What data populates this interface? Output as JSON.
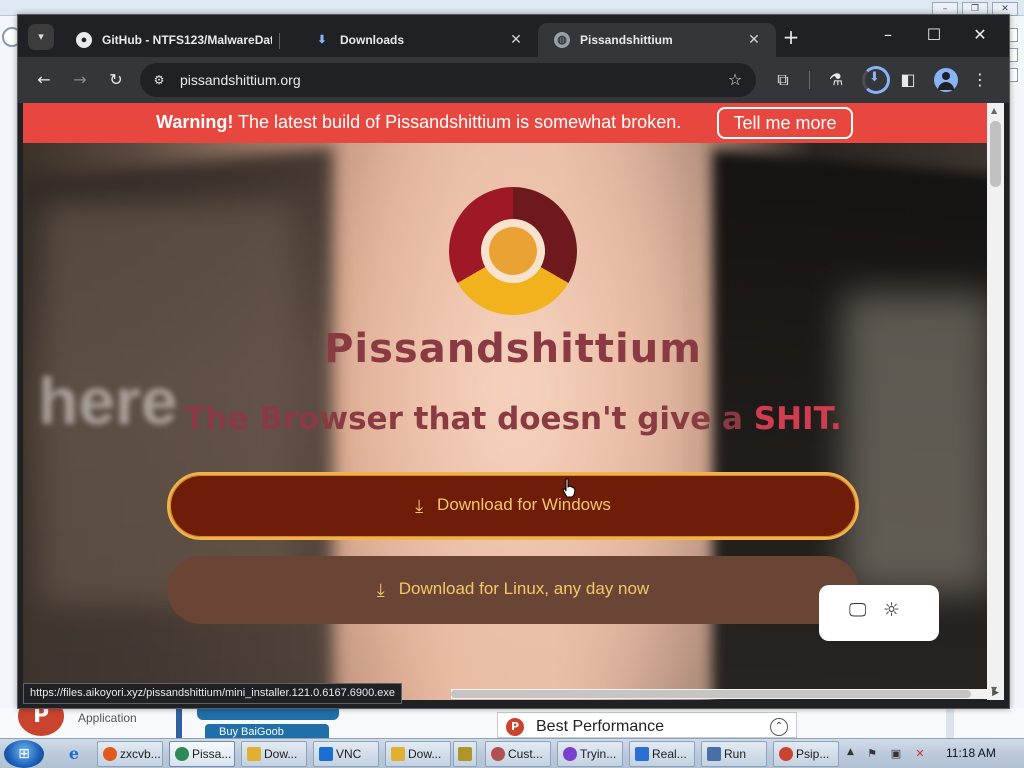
{
  "browser": {
    "tabs": [
      {
        "title": "GitHub - NTFS123/MalwareDat",
        "icon": "github-icon"
      },
      {
        "title": "Downloads",
        "icon": "download-icon"
      },
      {
        "title": "Pissandshittium",
        "icon": "globe-icon"
      }
    ],
    "active_tab": 2,
    "url": "pissandshittium.org",
    "status_url": "https://files.aikoyori.xyz/pissandshittium/mini_installer.121.0.6167.6900.exe"
  },
  "page": {
    "warning": {
      "strong": "Warning!",
      "text": " The latest build of Pissandshittium is somewhat broken.",
      "button": "Tell me more"
    },
    "brand": "Pissandshittium",
    "tagline": {
      "part1": "The Browser that doesn't give a ",
      "part2": "SHIT."
    },
    "background_text": "here",
    "download_windows": "Download for Windows",
    "download_linux": "Download for Linux, any day now"
  },
  "background_window": {
    "app_label": "Application",
    "button_text": "Buy BaiGoob",
    "panel_label": "Best Performance"
  },
  "taskbar": {
    "items": [
      {
        "label": "zxcvb...",
        "color": "#e05a1b"
      },
      {
        "label": "Pissa...",
        "color": "#2e8b57",
        "active": true
      },
      {
        "label": "Dow...",
        "color": "#e0b030"
      },
      {
        "label": "VNC",
        "color": "#1a6fd1"
      },
      {
        "label": "Dow...",
        "color": "#e0b030"
      },
      {
        "label": "",
        "color": "#b0952a"
      },
      {
        "label": "Cust...",
        "color": "#b05050"
      },
      {
        "label": "Tryin...",
        "color": "#7b3fd0"
      },
      {
        "label": "Real...",
        "color": "#2a6fd1"
      },
      {
        "label": "Run",
        "color": "#4a6fa5"
      },
      {
        "label": "Psip...",
        "color": "#c9432f"
      }
    ],
    "clock": "11:18 AM"
  },
  "colors": {
    "warning_bg": "#e8473f",
    "brand": "#8a3a42",
    "tagline_accent": "#d23c4f",
    "windows_button": "#6f1d08",
    "windows_button_border": "#f0b24a",
    "linux_button": "#6a4535",
    "button_text": "#f6c768"
  }
}
